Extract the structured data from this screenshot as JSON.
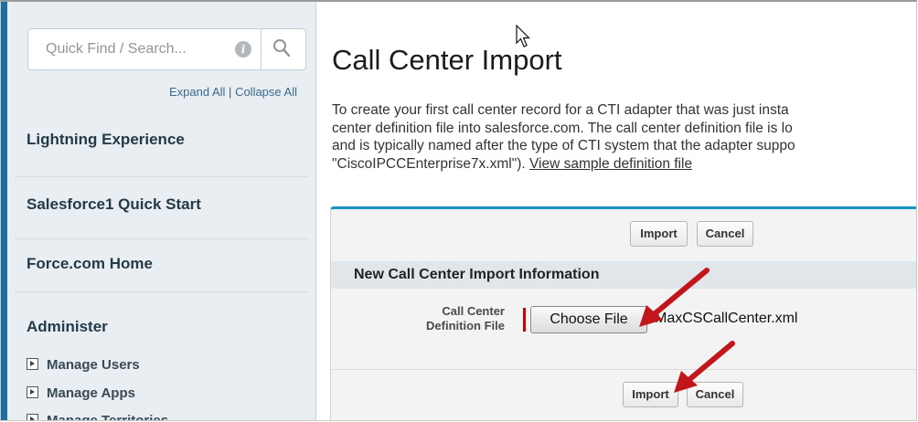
{
  "sidebar": {
    "search_placeholder": "Quick Find / Search...",
    "expand_all": "Expand All",
    "separator": "|",
    "collapse_all": "Collapse All",
    "items": [
      {
        "label": "Lightning Experience"
      },
      {
        "label": "Salesforce1 Quick Start"
      },
      {
        "label": "Force.com Home"
      }
    ],
    "admin_title": "Administer",
    "admin_items": [
      {
        "label": "Manage Users"
      },
      {
        "label": "Manage Apps"
      },
      {
        "label": "Manage Territories"
      }
    ]
  },
  "main": {
    "title": "Call Center Import",
    "description_lines": [
      "To create your first call center record for a CTI adapter that was just insta",
      "center definition file into salesforce.com. The call center definition file is lo",
      "and is typically named after the type of CTI system that the adapter suppo",
      "\"CiscoIPCCEnterprise7x.xml\")."
    ],
    "sample_link": "View sample definition file",
    "buttons": {
      "import": "Import",
      "cancel": "Cancel"
    },
    "section_title": "New Call Center Import Information",
    "field_label": "Call Center\nDefinition File",
    "choose_file": "Choose File",
    "file_name": "MaxCSCallCenter.xml"
  },
  "colors": {
    "accent_bar": "#1797c0",
    "left_strip": "#1f6f9e",
    "annotation_arrow": "#c0161c",
    "required": "#cc0000"
  },
  "icons": [
    "info-icon",
    "search-icon",
    "expand-triangle-icon",
    "mouse-cursor-icon",
    "annotation-arrow"
  ]
}
